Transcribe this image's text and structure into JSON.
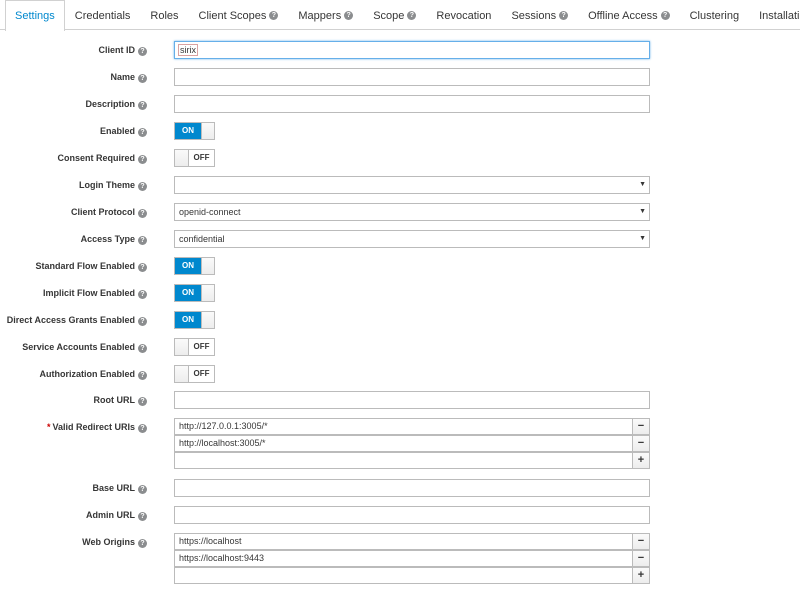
{
  "tabs": [
    {
      "label": "Settings",
      "help": false
    },
    {
      "label": "Credentials",
      "help": false
    },
    {
      "label": "Roles",
      "help": false
    },
    {
      "label": "Client Scopes",
      "help": true
    },
    {
      "label": "Mappers",
      "help": true
    },
    {
      "label": "Scope",
      "help": true
    },
    {
      "label": "Revocation",
      "help": false
    },
    {
      "label": "Sessions",
      "help": true
    },
    {
      "label": "Offline Access",
      "help": true
    },
    {
      "label": "Clustering",
      "help": false
    },
    {
      "label": "Installation",
      "help": true
    }
  ],
  "help_glyph": "?",
  "form": {
    "client_id": {
      "label": "Client ID",
      "value": "sirix"
    },
    "name": {
      "label": "Name",
      "value": ""
    },
    "description": {
      "label": "Description",
      "value": ""
    },
    "enabled": {
      "label": "Enabled",
      "state": "ON"
    },
    "consent_required": {
      "label": "Consent Required",
      "state": "OFF"
    },
    "login_theme": {
      "label": "Login Theme",
      "value": ""
    },
    "client_protocol": {
      "label": "Client Protocol",
      "value": "openid-connect"
    },
    "access_type": {
      "label": "Access Type",
      "value": "confidential"
    },
    "standard_flow": {
      "label": "Standard Flow Enabled",
      "state": "ON"
    },
    "implicit_flow": {
      "label": "Implicit Flow Enabled",
      "state": "ON"
    },
    "direct_access": {
      "label": "Direct Access Grants Enabled",
      "state": "ON"
    },
    "service_accounts": {
      "label": "Service Accounts Enabled",
      "state": "OFF"
    },
    "authorization": {
      "label": "Authorization Enabled",
      "state": "OFF"
    },
    "root_url": {
      "label": "Root URL",
      "value": ""
    },
    "redirect_uris": {
      "label": "Valid Redirect URIs",
      "required_mark": "*",
      "values": [
        "http://127.0.0.1:3005/*",
        "http://localhost:3005/*"
      ],
      "new_value": ""
    },
    "base_url": {
      "label": "Base URL",
      "value": ""
    },
    "admin_url": {
      "label": "Admin URL",
      "value": ""
    },
    "web_origins": {
      "label": "Web Origins",
      "values": [
        "https://localhost",
        "https://localhost:9443"
      ],
      "new_value": ""
    }
  },
  "buttons": {
    "remove": "−",
    "add": "+"
  },
  "icons": {
    "help": "help-circle-icon",
    "caret": "caret-down-icon",
    "accent": "#0088ce"
  }
}
